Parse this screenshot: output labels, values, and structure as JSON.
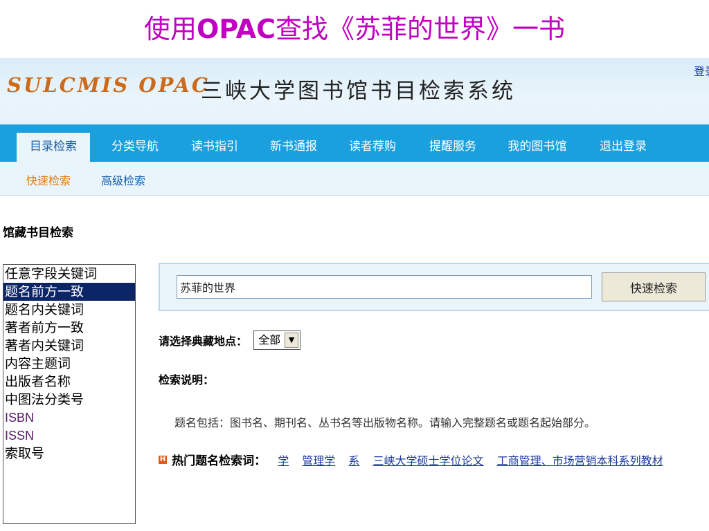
{
  "slide": {
    "title_prefix": "使用",
    "title_bold": "OPAC",
    "title_suffix": "查找《苏菲的世界》一书"
  },
  "header": {
    "logo": "SULCMIS OPAC",
    "system_title": "三峡大学图书馆书目检索系统",
    "login_link": "登录"
  },
  "nav": {
    "items": [
      "目录检索",
      "分类导航",
      "读书指引",
      "新书通报",
      "读者荐购",
      "提醒服务",
      "我的图书馆",
      "退出登录"
    ],
    "active_index": 0
  },
  "subnav": {
    "items": [
      "快速检索",
      "高级检索"
    ],
    "active_index": 0
  },
  "search": {
    "section_title": "馆藏书目检索",
    "field_options": [
      "任意字段关键词",
      "题名前方一致",
      "题名内关键词",
      "著者前方一致",
      "著者内关键词",
      "内容主题词",
      "出版者名称",
      "中图法分类号",
      "ISBN",
      "ISSN",
      "索取号"
    ],
    "selected_field": "题名前方一致",
    "query_value": "苏菲的世界",
    "button_label": "快速检索",
    "location_label": "请选择典藏地点：",
    "location_value": "全部",
    "help_title": "检索说明：",
    "help_text": "题名包括：图书名、期刊名、丛书名等出版物名称。请输入完整题名或题名起始部分。",
    "hot_icon": "H",
    "hot_label": "热门题名检索词：",
    "hot_terms": [
      "学",
      "管理学",
      "系",
      "三峡大学硕士学位论文",
      "工商管理、市场营销本科系列教材"
    ]
  },
  "colors": {
    "title": "#c000c0",
    "nav_bg": "#1aa0df",
    "subnav_bg": "#e9f4fb",
    "subnav_active": "#e07a14",
    "link": "#1a3a9a",
    "selected_bg": "#0b2566"
  }
}
